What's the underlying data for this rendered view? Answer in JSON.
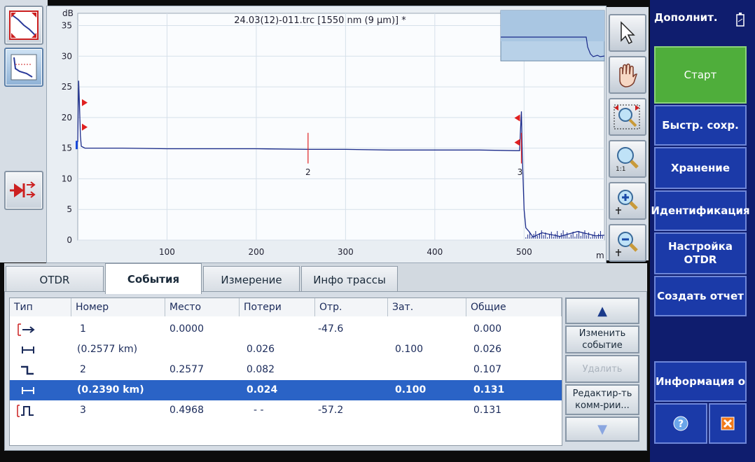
{
  "chart": {
    "title": "24.03(12)-011.trc [1550 nm (9 µm)] *",
    "y_unit": "dB",
    "x_unit": "m",
    "y_ticks": [
      "35",
      "30",
      "25",
      "20",
      "15",
      "10",
      "5",
      "0"
    ],
    "x_ticks": [
      "100",
      "200",
      "300",
      "400",
      "500"
    ],
    "markers": [
      "2",
      "3"
    ]
  },
  "chart_data": {
    "type": "line",
    "title": "24.03(12)-011.trc [1550 nm (9 µm)] *",
    "xlabel": "m",
    "ylabel": "dB",
    "xlim": [
      0,
      590
    ],
    "ylim": [
      0,
      37
    ],
    "grid": true,
    "series": [
      {
        "x": [
          0,
          1,
          2,
          3,
          4,
          8,
          50,
          100,
          150,
          200,
          258,
          300,
          350,
          400,
          450,
          490,
          495,
          496,
          497,
          498,
          500,
          502,
          505,
          510,
          520,
          540,
          560,
          580,
          590
        ],
        "y": [
          16,
          26,
          22,
          17,
          15.3,
          15.0,
          15.0,
          14.9,
          14.9,
          14.9,
          14.8,
          14.8,
          14.7,
          14.7,
          14.7,
          14.6,
          14.6,
          18,
          21,
          14,
          5,
          2,
          1.5,
          0.5,
          1.2,
          0.6,
          1.4,
          0.7,
          0.8
        ]
      }
    ],
    "events": [
      {
        "label": "2",
        "x": 258
      },
      {
        "label": "3",
        "x": 497
      }
    ]
  },
  "left_toolbar": {
    "full_view_icon": "zoom-fit-icon",
    "trace_view_icon": "trace-thumbnail-icon",
    "laser_icon": "laser-source-icon"
  },
  "zoom_toolbar": {
    "items": [
      "cursor-arrow-icon",
      "hand-pan-icon",
      "zoom-area-icon",
      "zoom-1to1-icon",
      "zoom-in-icon",
      "zoom-out-icon"
    ]
  },
  "menu": {
    "title": "Дополнит.",
    "start": "Старт",
    "quick_save": "Быстр. сохр.",
    "storage": "Хранение",
    "identification": "Идентификация",
    "otdr_settings": "Настройка OTDR",
    "create_report": "Создать отчет",
    "info": "Информация о"
  },
  "tabs": [
    "OTDR",
    "События",
    "Измерение",
    "Инфо трассы"
  ],
  "table": {
    "headers": [
      "Тип",
      "Номер",
      "Место",
      "Потери",
      "Отр.",
      "Зат.",
      "Общие"
    ],
    "rows": [
      {
        "icon": "launch-event-icon",
        "number": "1",
        "place": "0.0000",
        "loss": "",
        "refl": "-47.6",
        "att": "",
        "total": "0.000"
      },
      {
        "icon": "fiber-section-icon",
        "number": "(0.2577 km)",
        "place": "",
        "loss": "0.026",
        "refl": "",
        "att": "0.100",
        "total": "0.026"
      },
      {
        "icon": "splice-event-icon",
        "number": "2",
        "place": "0.2577",
        "loss": "0.082",
        "refl": "",
        "att": "",
        "total": "0.107"
      },
      {
        "icon": "fiber-section-icon",
        "number": "(0.2390 km)",
        "place": "",
        "loss": "0.024",
        "refl": "",
        "att": "0.100",
        "total": "0.131"
      },
      {
        "icon": "end-event-icon",
        "number": "3",
        "place": "0.4968",
        "loss": "- -",
        "refl": "-57.2",
        "att": "",
        "total": "0.131"
      }
    ]
  },
  "table_buttons": {
    "up": "▲",
    "edit_event": "Изменить событие",
    "delete": "Удалить",
    "edit_comments": "Редактир-ть комм-рии...",
    "down": "▼"
  },
  "colors": {
    "menu_bg": "#0f1d6e",
    "button_blue": "#1b3aa8",
    "start_green": "#4fae3b",
    "selection": "#2a63c6",
    "trace": "#1a2a8a",
    "marker_red": "#e02020"
  }
}
